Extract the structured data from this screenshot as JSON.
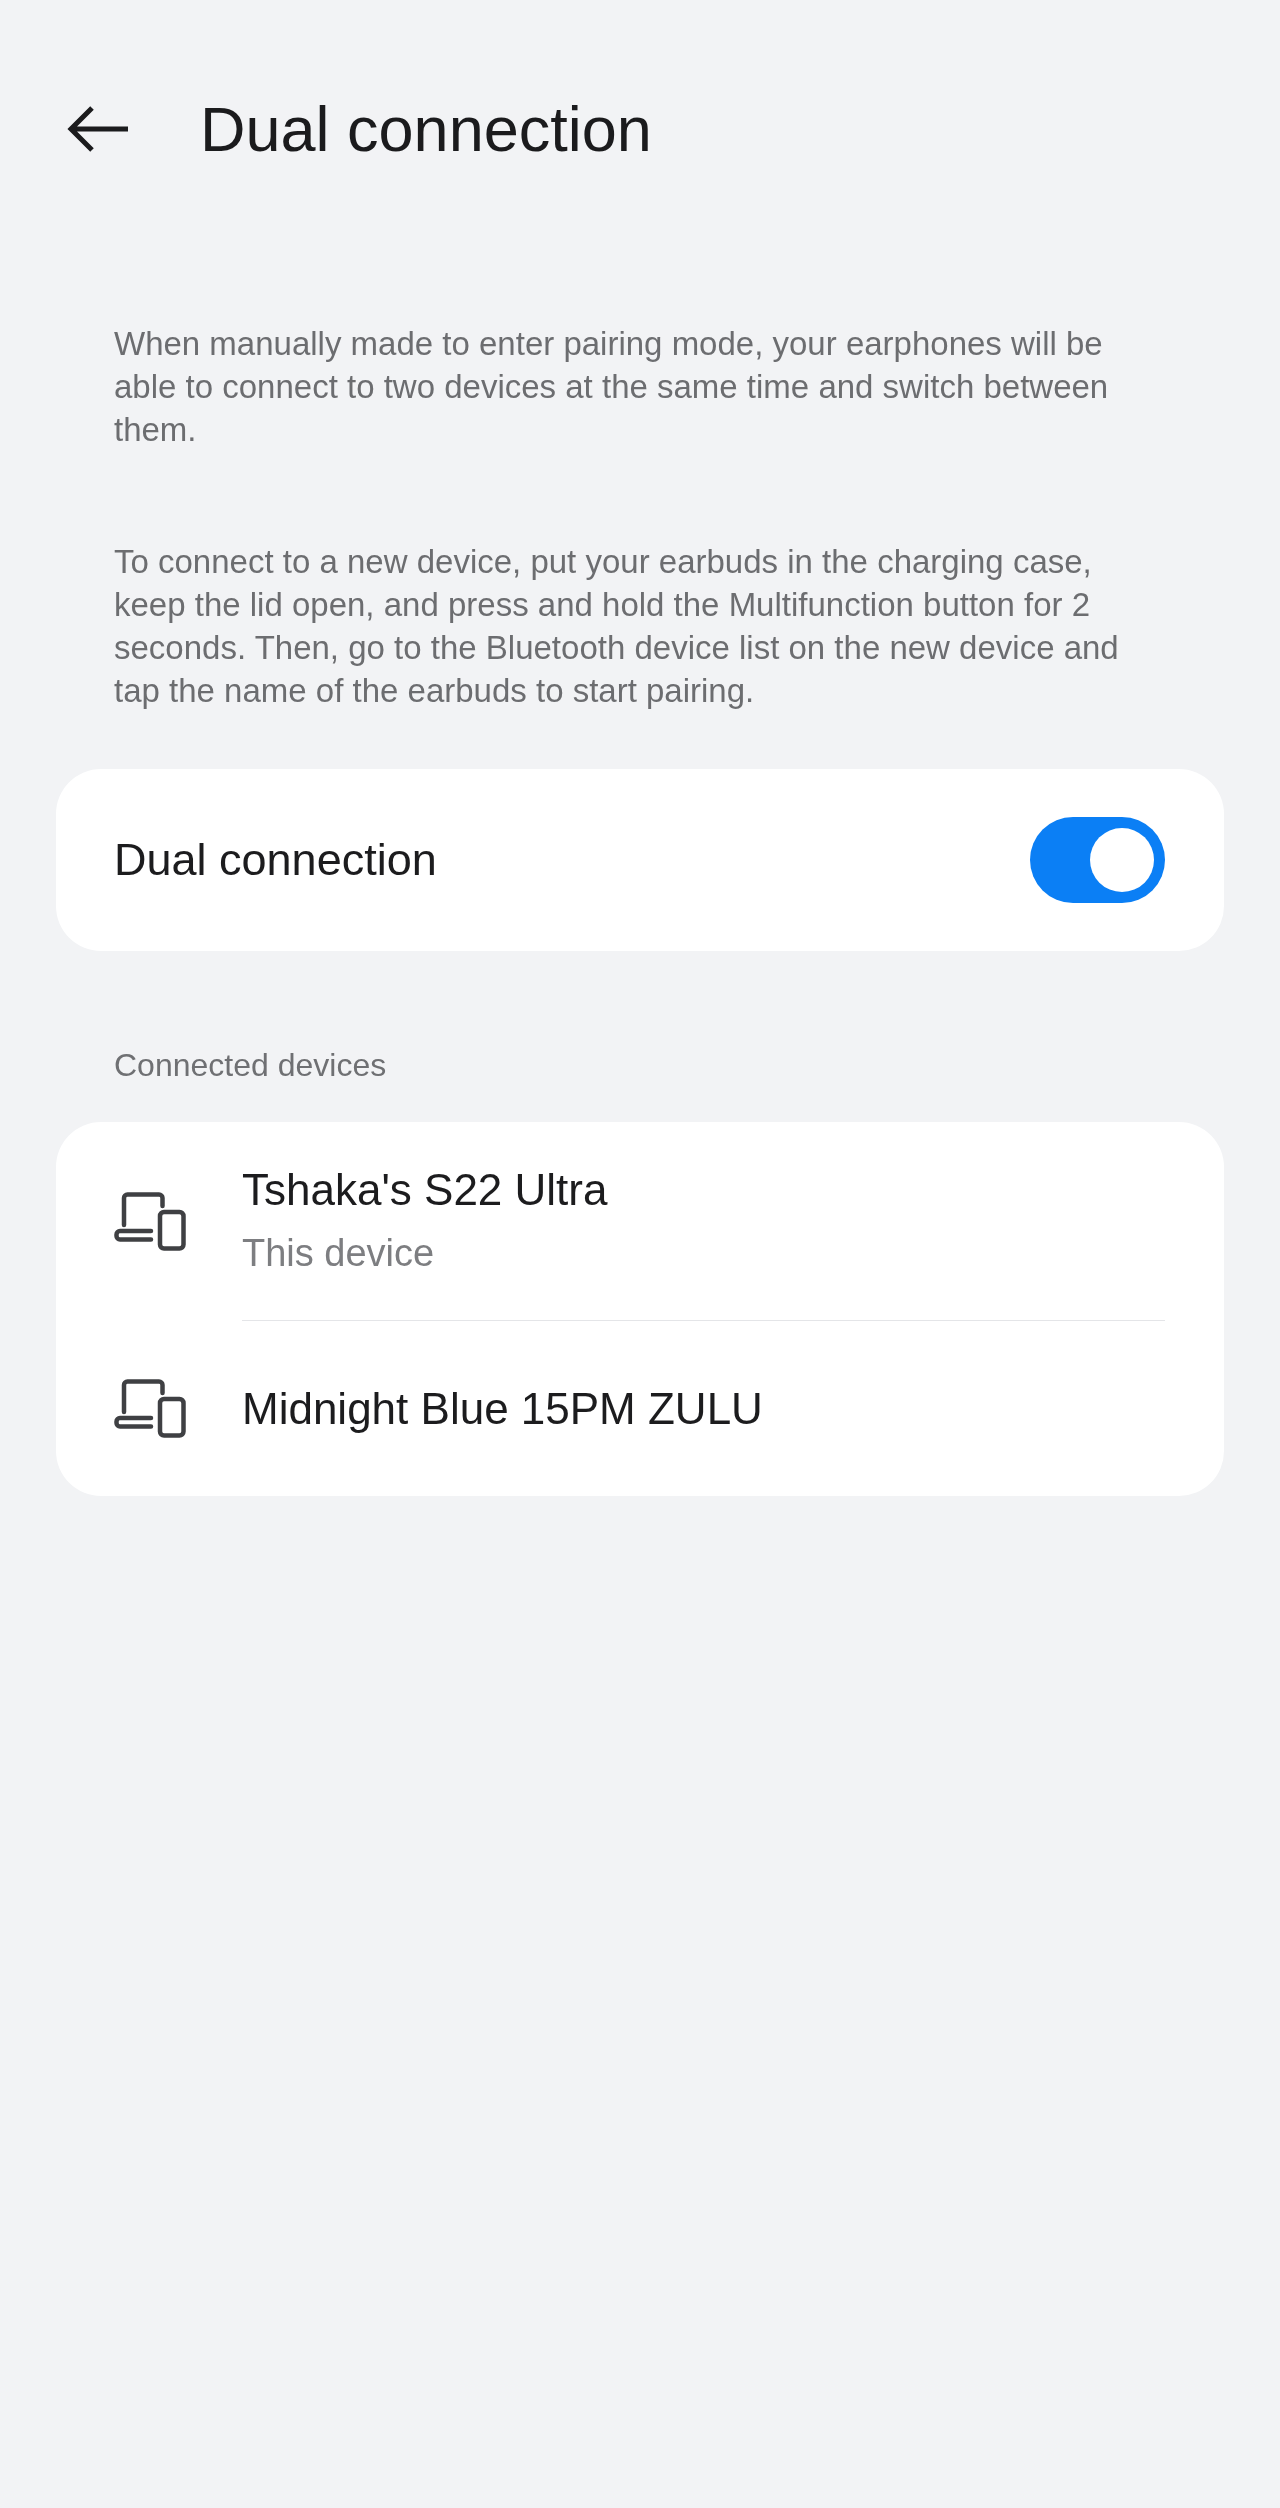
{
  "header": {
    "title": "Dual connection"
  },
  "descriptions": [
    "When manually made to enter pairing mode, your earphones will be able to connect to two devices at the same time and switch between them.",
    "To connect to a new device, put your earbuds in the charging case, keep the lid open, and press and hold the Multifunction button for 2 seconds. Then, go to the Bluetooth device list on the new device and tap the name of the earbuds to start pairing."
  ],
  "toggle": {
    "label": "Dual connection",
    "on": true
  },
  "connected_devices": {
    "heading": "Connected devices",
    "devices": [
      {
        "name": "Tshaka's S22 Ultra",
        "subtitle": "This device"
      },
      {
        "name": "Midnight Blue 15PM ZULU"
      }
    ]
  }
}
